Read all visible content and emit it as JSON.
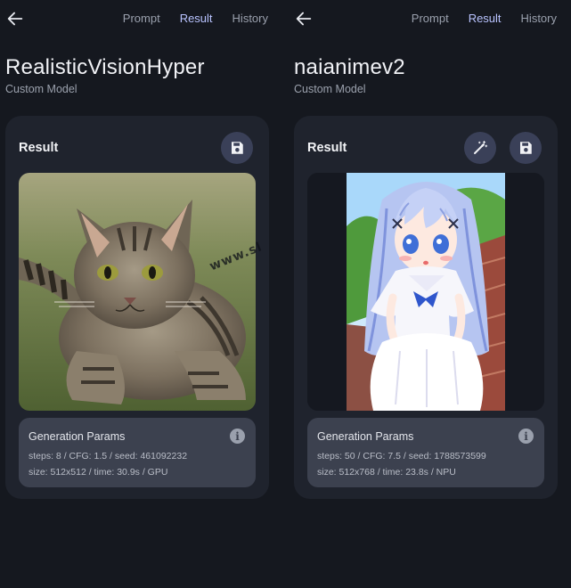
{
  "tabs": [
    "Prompt",
    "Result",
    "History"
  ],
  "active_tab": "Result",
  "panels": [
    {
      "model_name": "RealisticVisionHyper",
      "model_type": "Custom Model",
      "card_title": "Result",
      "params_title": "Generation Params",
      "params_line1": "steps: 8 / CFG: 1.5 / seed: 461092232",
      "params_line2": "size: 512x512 / time: 30.9s / GPU"
    },
    {
      "model_name": "naianimev2",
      "model_type": "Custom Model",
      "card_title": "Result",
      "params_title": "Generation Params",
      "params_line1": "steps: 50 / CFG: 7.5 / seed: 1788573599",
      "params_line2": "size: 512x768 / time: 23.8s / NPU"
    }
  ],
  "watermark": "www.sl",
  "icons": {
    "back": "arrow-left-icon",
    "save": "floppy-disk-icon",
    "enhance": "magic-wand-icon",
    "info": "info-icon"
  },
  "colors": {
    "background": "#15181f",
    "card": "#1f232d",
    "active_tab": "#b9c3ff",
    "icon_button": "#3a4058",
    "params_box": "#3c414f"
  }
}
